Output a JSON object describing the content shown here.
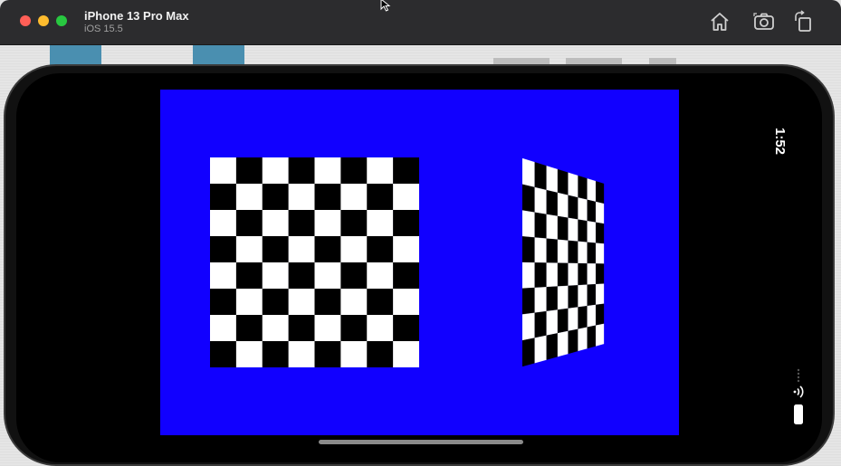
{
  "window": {
    "device_name": "iPhone 13 Pro Max",
    "os_version": "iOS 15.5",
    "buttons": {
      "home": "home-icon",
      "screenshot": "screenshot-icon",
      "rotate": "rotate-icon"
    },
    "traffic_lights": [
      "#ff5f57",
      "#febc2e",
      "#28c840"
    ]
  },
  "status_bar": {
    "time": "1:52",
    "icons": [
      "wifi-icon",
      "battery-icon"
    ]
  },
  "app": {
    "background_color": "#1100ff",
    "boards": [
      {
        "name": "flat-checkerboard",
        "rows": 8,
        "cols": 8
      },
      {
        "name": "perspective-checkerboard",
        "rows": 8,
        "cols": 8
      }
    ]
  }
}
